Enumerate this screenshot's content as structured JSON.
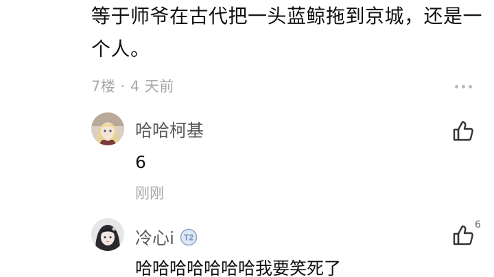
{
  "post": {
    "lines": [
      "等于师爷在古代把一头蓝鲸拖到京城，还是一",
      "个人。"
    ],
    "meta": "7楼 · 4 天前"
  },
  "replies": [
    {
      "username": "哈哈柯基",
      "text": "6",
      "time": "刚刚",
      "avatar_icon": "anime-blonde-avatar",
      "like_count": ""
    },
    {
      "username": "冷心i",
      "badge": "T2",
      "text": "哈哈哈哈哈哈哈我要笑死了",
      "avatar_icon": "anime-black-hair-avatar",
      "like_count": "6"
    }
  ],
  "colors": {
    "meta_gray": "#a8a8a8",
    "username_gray": "#5a5a5a",
    "text_black": "#111111",
    "badge_blue": "#6f8fbf"
  }
}
